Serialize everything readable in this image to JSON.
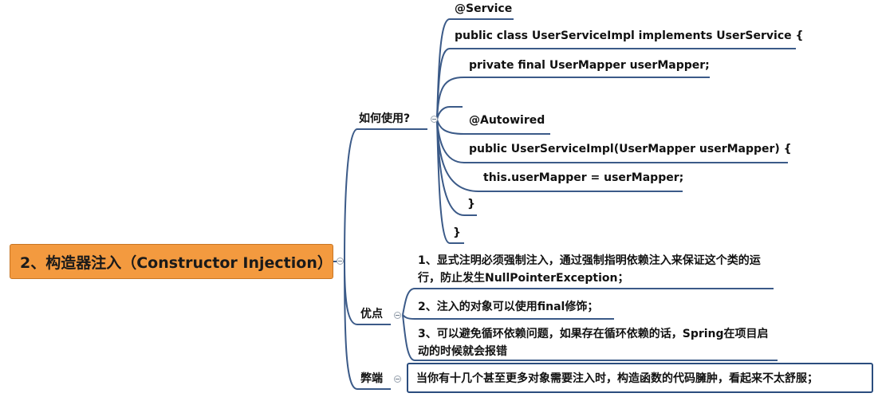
{
  "root": {
    "label": "2、构造器注入（Constructor Injection）"
  },
  "branches": {
    "usage": {
      "label": "如何使用?",
      "lines": [
        "@Service",
        "public class UserServiceImpl implements UserService {",
        "private final UserMapper userMapper;",
        "",
        "@Autowired",
        "public UserServiceImpl(UserMapper userMapper) {",
        "this.userMapper = userMapper;",
        "}",
        "}"
      ]
    },
    "advantages": {
      "label": "优点",
      "items": [
        "1、显式注明必须强制注入，通过强制指明依赖注入来保证这个类的运行，防止发生NullPointerException；",
        "2、注入的对象可以使用final修饰；",
        "3、可以避免循环依赖问题，如果存在循环依赖的话，Spring在项目启动的时候就会报错"
      ]
    },
    "disadvantages": {
      "label": "弊端",
      "items": [
        "当你有十几个甚至更多对象需要注入时，构造函数的代码臃肿，看起来不太舒服；"
      ]
    }
  },
  "colors": {
    "root_fill": "#f39a3f",
    "connector": "#3b5a88",
    "box_border": "#2b4d7e"
  }
}
